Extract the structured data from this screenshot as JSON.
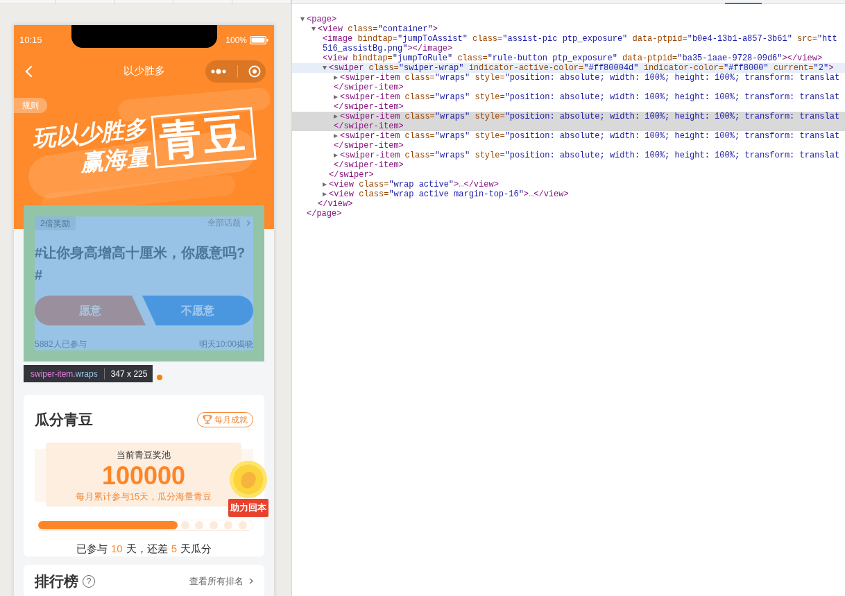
{
  "simulator": {
    "status_bar": {
      "time": "10:15",
      "battery": "100%"
    },
    "nav_bar": {
      "title": "以少胜多"
    },
    "rules_button": "规则",
    "banner": {
      "line_1": "玩以少胜多",
      "line_2": "赢海量",
      "highlight": "青豆"
    },
    "topic_card": {
      "badge": "2倍奖励",
      "all_topics": "全部话题",
      "question": "#让你身高增高十厘米，你愿意吗?#",
      "options": [
        {
          "label": "愿意",
          "kind": "yes"
        },
        {
          "label": "不愿意",
          "kind": "no"
        }
      ],
      "participants": "5882人已参与",
      "reveal_time": "明天10:00揭晓"
    },
    "inspector_tooltip": {
      "tag": "swiper-item",
      "class": ".wraps",
      "size": "347 x 225"
    },
    "pool_card": {
      "title": "瓜分青豆",
      "badge": "每月成就",
      "pool_label": "当前青豆奖池",
      "amount": "100000",
      "description": "每月累计参与15天，瓜分海量青豆",
      "assist_label": "助力回本",
      "progress": {
        "level": 0.66
      },
      "summary": [
        {
          "text": "已参与",
          "emphasis": false
        },
        {
          "text": "10",
          "emphasis": true
        },
        {
          "text": "天，还差",
          "emphasis": false
        },
        {
          "text": "5",
          "emphasis": true
        },
        {
          "text": "天瓜分",
          "emphasis": false
        }
      ]
    },
    "ranking_card": {
      "title": "排行榜",
      "help_mark": "?",
      "link": "查看所有排名"
    }
  },
  "devtools": {
    "tree": [
      {
        "kind": "parent",
        "expanded": true,
        "selected": false,
        "hovered": false,
        "lines": [
          [
            {
              "kind": "tag",
              "text": "<page>"
            }
          ]
        ],
        "close": [
          {
            "kind": "tag",
            "text": "</page>"
          }
        ],
        "children": [
          {
            "kind": "parent",
            "expanded": true,
            "selected": false,
            "hovered": false,
            "lines": [
              [
                {
                  "kind": "tag",
                  "text": "<view"
                },
                {
                  "kind": "attr",
                  "text": "class="
                },
                {
                  "kind": "value",
                  "text": "\"container\""
                },
                {
                  "kind": "tag",
                  "text": ">"
                }
              ]
            ],
            "close": [
              {
                "kind": "tag",
                "text": "</view>"
              }
            ],
            "children": [
              {
                "kind": "leaf",
                "selected": false,
                "hovered": false,
                "lines": [
                  [
                    {
                      "kind": "tag",
                      "text": "<image"
                    },
                    {
                      "kind": "attr",
                      "text": "bindtap="
                    },
                    {
                      "kind": "value",
                      "text": "\"jumpToAssist\""
                    },
                    {
                      "kind": "attr",
                      "text": "class="
                    },
                    {
                      "kind": "value",
                      "text": "\"assist-pic ptp_exposure\""
                    },
                    {
                      "kind": "attr",
                      "text": "data-ptpid="
                    },
                    {
                      "kind": "value",
                      "text": "\"b0e4-13b1-a857-3b61\""
                    },
                    {
                      "kind": "attr",
                      "text": "src="
                    },
                    {
                      "kind": "value",
                      "text": "\"htt"
                    }
                  ],
                  [
                    {
                      "kind": "value",
                      "text": "516_assistBg.png\""
                    },
                    {
                      "kind": "tag",
                      "text": "></image>"
                    }
                  ]
                ]
              },
              {
                "kind": "leaf",
                "selected": false,
                "hovered": false,
                "lines": [
                  [
                    {
                      "kind": "tag",
                      "text": "<view"
                    },
                    {
                      "kind": "attr",
                      "text": "bindtap="
                    },
                    {
                      "kind": "value",
                      "text": "\"jumpToRule\""
                    },
                    {
                      "kind": "attr",
                      "text": "class="
                    },
                    {
                      "kind": "value",
                      "text": "\"rule-button ptp_exposure\""
                    },
                    {
                      "kind": "attr",
                      "text": "data-ptpid="
                    },
                    {
                      "kind": "value",
                      "text": "\"ba35-1aae-9728-09d6\""
                    },
                    {
                      "kind": "tag",
                      "text": "></view>"
                    }
                  ]
                ]
              },
              {
                "kind": "parent",
                "expanded": true,
                "selected": true,
                "hovered": false,
                "lines": [
                  [
                    {
                      "kind": "tag",
                      "text": "<swiper"
                    },
                    {
                      "kind": "attr",
                      "text": "class="
                    },
                    {
                      "kind": "value",
                      "text": "\"swiper-wrap\""
                    },
                    {
                      "kind": "attr",
                      "text": "indicator-active-color="
                    },
                    {
                      "kind": "value",
                      "text": "\"#ff80004d\""
                    },
                    {
                      "kind": "attr",
                      "text": "indicator-color="
                    },
                    {
                      "kind": "value",
                      "text": "\"#ff8000\""
                    },
                    {
                      "kind": "attr",
                      "text": "current="
                    },
                    {
                      "kind": "value",
                      "text": "\"2\""
                    },
                    {
                      "kind": "tag",
                      "text": ">"
                    }
                  ]
                ],
                "close": [
                  {
                    "kind": "tag",
                    "text": "</swiper>"
                  }
                ],
                "children": [
                  {
                    "kind": "parent",
                    "expanded": false,
                    "selected": false,
                    "hovered": false,
                    "lines": [
                      [
                        {
                          "kind": "tag",
                          "text": "<swiper-item"
                        },
                        {
                          "kind": "attr",
                          "text": "class="
                        },
                        {
                          "kind": "value",
                          "text": "\"wraps\""
                        },
                        {
                          "kind": "attr",
                          "text": "style="
                        },
                        {
                          "kind": "value",
                          "text": "\"position: absolute; width: 100%; height: 100%; transform: translat"
                        }
                      ],
                      [
                        {
                          "kind": "tag",
                          "text": "</swiper-item>"
                        }
                      ]
                    ]
                  },
                  {
                    "kind": "parent",
                    "expanded": false,
                    "selected": false,
                    "hovered": false,
                    "lines": [
                      [
                        {
                          "kind": "tag",
                          "text": "<swiper-item"
                        },
                        {
                          "kind": "attr",
                          "text": "class="
                        },
                        {
                          "kind": "value",
                          "text": "\"wraps\""
                        },
                        {
                          "kind": "attr",
                          "text": "style="
                        },
                        {
                          "kind": "value",
                          "text": "\"position: absolute; width: 100%; height: 100%; transform: translat"
                        }
                      ],
                      [
                        {
                          "kind": "tag",
                          "text": "</swiper-item>"
                        }
                      ]
                    ]
                  },
                  {
                    "kind": "parent",
                    "expanded": false,
                    "selected": false,
                    "hovered": true,
                    "lines": [
                      [
                        {
                          "kind": "tag",
                          "text": "<swiper-item"
                        },
                        {
                          "kind": "attr",
                          "text": "class="
                        },
                        {
                          "kind": "value",
                          "text": "\"wraps\""
                        },
                        {
                          "kind": "attr",
                          "text": "style="
                        },
                        {
                          "kind": "value",
                          "text": "\"position: absolute; width: 100%; height: 100%; transform: translat"
                        }
                      ],
                      [
                        {
                          "kind": "tag",
                          "text": "</swiper-item>"
                        }
                      ]
                    ]
                  },
                  {
                    "kind": "parent",
                    "expanded": false,
                    "selected": false,
                    "hovered": false,
                    "lines": [
                      [
                        {
                          "kind": "tag",
                          "text": "<swiper-item"
                        },
                        {
                          "kind": "attr",
                          "text": "class="
                        },
                        {
                          "kind": "value",
                          "text": "\"wraps\""
                        },
                        {
                          "kind": "attr",
                          "text": "style="
                        },
                        {
                          "kind": "value",
                          "text": "\"position: absolute; width: 100%; height: 100%; transform: translat"
                        }
                      ],
                      [
                        {
                          "kind": "tag",
                          "text": "</swiper-item>"
                        }
                      ]
                    ]
                  },
                  {
                    "kind": "parent",
                    "expanded": false,
                    "selected": false,
                    "hovered": false,
                    "lines": [
                      [
                        {
                          "kind": "tag",
                          "text": "<swiper-item"
                        },
                        {
                          "kind": "attr",
                          "text": "class="
                        },
                        {
                          "kind": "value",
                          "text": "\"wraps\""
                        },
                        {
                          "kind": "attr",
                          "text": "style="
                        },
                        {
                          "kind": "value",
                          "text": "\"position: absolute; width: 100%; height: 100%; transform: translat"
                        }
                      ],
                      [
                        {
                          "kind": "tag",
                          "text": "</swiper-item>"
                        }
                      ]
                    ]
                  }
                ]
              },
              {
                "kind": "parent",
                "expanded": false,
                "selected": false,
                "hovered": false,
                "lines": [
                  [
                    {
                      "kind": "tag",
                      "text": "<view"
                    },
                    {
                      "kind": "attr",
                      "text": "class="
                    },
                    {
                      "kind": "value",
                      "text": "\"wrap active\""
                    },
                    {
                      "kind": "tag",
                      "text": ">"
                    },
                    {
                      "kind": "ellipsis",
                      "text": "…"
                    },
                    {
                      "kind": "tag",
                      "text": "</view>"
                    }
                  ]
                ]
              },
              {
                "kind": "parent",
                "expanded": false,
                "selected": false,
                "hovered": false,
                "lines": [
                  [
                    {
                      "kind": "tag",
                      "text": "<view"
                    },
                    {
                      "kind": "attr",
                      "text": "class="
                    },
                    {
                      "kind": "value",
                      "text": "\"wrap active margin-top-16\""
                    },
                    {
                      "kind": "tag",
                      "text": ">"
                    },
                    {
                      "kind": "ellipsis",
                      "text": "…"
                    },
                    {
                      "kind": "tag",
                      "text": "</view>"
                    }
                  ]
                ]
              }
            ]
          }
        ]
      }
    ]
  }
}
